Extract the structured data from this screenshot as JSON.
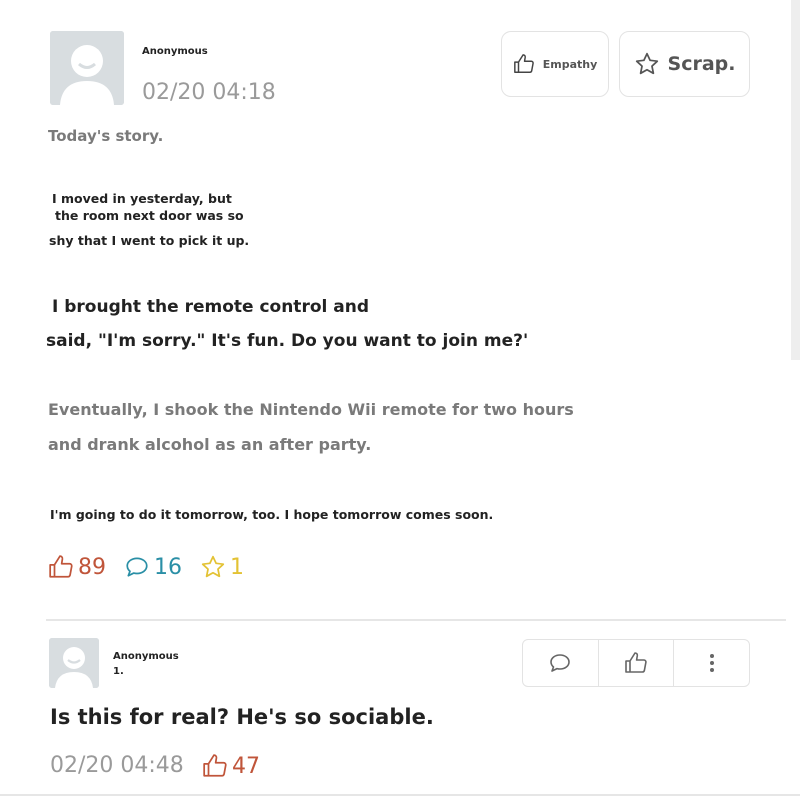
{
  "post": {
    "author": "Anonymous",
    "timestamp": "02/20 04:18",
    "empathy_label": "Empathy",
    "scrap_label": "Scrap.",
    "title": "Today's story.",
    "p1_line1": "I moved in yesterday, but",
    "p1_line2": "the room next door was so",
    "p1_line3": "shy that I went to pick it up.",
    "p2_line1": "I brought the remote control and",
    "p2_line2": "said, \"I'm sorry.\" It's fun. Do you want to join me?'",
    "p3_line1": "Eventually, I shook the Nintendo Wii remote for two hours",
    "p3_line2": "and drank alcohol as an after party.",
    "p4_line1": "I'm going to do it tomorrow, too. I hope tomorrow comes soon.",
    "likes": "89",
    "comments": "16",
    "scraps": "1"
  },
  "comment": {
    "author": "Anonymous",
    "index": "1.",
    "text": "Is this for real? He's so sociable.",
    "timestamp": "02/20 04:48",
    "likes": "47"
  },
  "colors": {
    "like": "#c0553a",
    "comment": "#2a8fa6",
    "scrap": "#e3c234",
    "grey_text": "#7a7a7a",
    "border": "#e3e3e3"
  },
  "icons": [
    "avatar-icon",
    "thumbs-up-icon",
    "star-icon",
    "speech-bubble-icon",
    "more-vertical-icon"
  ]
}
